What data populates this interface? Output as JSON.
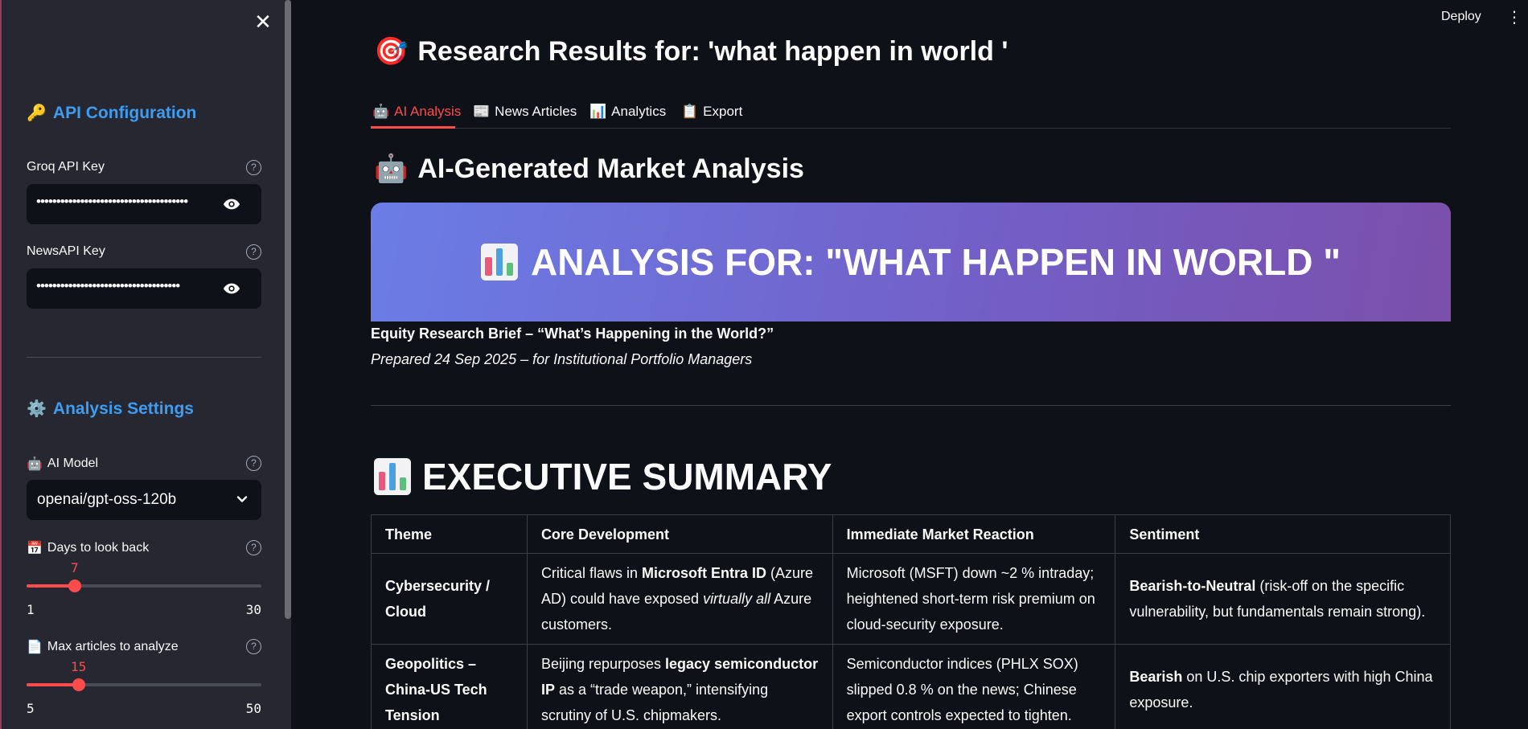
{
  "sidebar": {
    "api_heading": "API Configuration",
    "groq_label": "Groq API Key",
    "groq_value": "••••••••••••••••••••••••••••••••••••••",
    "newsapi_label": "NewsAPI Key",
    "newsapi_value": "••••••••••••••••••••••••••••••••••••",
    "settings_heading": "Analysis Settings",
    "model_label": "AI Model",
    "model_value": "openai/gpt-oss-120b",
    "days_label": "Days to look back",
    "days": {
      "value": "7",
      "min": "1",
      "max": "30",
      "fraction": 0.2069
    },
    "articles_label": "Max articles to analyze",
    "articles": {
      "value": "15",
      "min": "5",
      "max": "50",
      "fraction": 0.2222
    }
  },
  "header": {
    "deploy_label": "Deploy"
  },
  "main": {
    "title": "Research Results for: 'what happen in world '",
    "tabs": [
      {
        "label": "AI Analysis",
        "emoji": "🤖"
      },
      {
        "label": "News Articles",
        "emoji": "📰"
      },
      {
        "label": "Analytics",
        "emoji": "📊"
      },
      {
        "label": "Export",
        "emoji": "📋"
      }
    ],
    "section_title": "AI-Generated Market Analysis",
    "banner_text": "ANALYSIS FOR: \"WHAT HAPPEN IN WORLD \"",
    "brief_title": "Equity Research Brief – “What’s Happening in the World?”",
    "brief_subtitle": "Prepared 24 Sep 2025 – for Institutional Portfolio Managers",
    "exec_heading": "EXECUTIVE SUMMARY",
    "table": {
      "headers": [
        "Theme",
        "Core Development",
        "Immediate Market Reaction",
        "Sentiment"
      ],
      "rows": [
        {
          "theme": "Cybersecurity / Cloud",
          "core_a": "Critical flaws in ",
          "core_b": "Microsoft Entra ID",
          "core_c": " (Azure AD) could have exposed ",
          "core_d": "virtually all",
          "core_e": " Azure customers.",
          "reaction": "Microsoft (MSFT) down ~2 % intraday; heightened short-term risk premium on cloud-security exposure.",
          "sent_a": "Bearish-to-Neutral",
          "sent_b": " (risk-off on the specific vulnerability, but fundamentals remain strong)."
        },
        {
          "theme": "Geopolitics – China-US Tech Tension",
          "core_a": "Beijing repurposes ",
          "core_b": "legacy semiconductor IP",
          "core_c": " as a “trade weapon,” intensifying scrutiny of U.S. chipmakers.",
          "core_d": "",
          "core_e": "",
          "reaction": "Semiconductor indices (PHLX SOX) slipped 0.8 % on the news; Chinese export controls expected to tighten.",
          "sent_a": "Bearish",
          "sent_b": " on U.S. chip exporters with high China exposure."
        }
      ]
    }
  }
}
